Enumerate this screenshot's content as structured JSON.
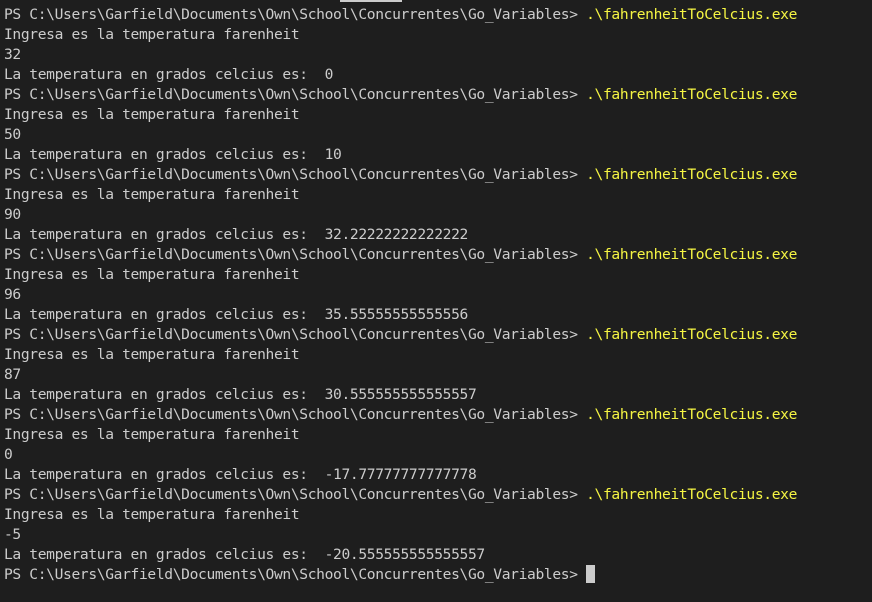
{
  "terminal": {
    "prompt": "PS C:\\Users\\Garfield\\Documents\\Own\\School\\Concurrentes\\Go_Variables>",
    "command": ".\\fahrenheitToCelcius.exe",
    "colors": {
      "background": "#1e1e1e",
      "text": "#cccccc",
      "command": "#f5f543"
    },
    "runs": [
      {
        "question": "Ingresa es la temperatura farenheit",
        "input": "32",
        "result": "La temperatura en grados celcius es:  0"
      },
      {
        "question": "Ingresa es la temperatura farenheit",
        "input": "50",
        "result": "La temperatura en grados celcius es:  10"
      },
      {
        "question": "Ingresa es la temperatura farenheit",
        "input": "90",
        "result": "La temperatura en grados celcius es:  32.22222222222222"
      },
      {
        "question": "Ingresa es la temperatura farenheit",
        "input": "96",
        "result": "La temperatura en grados celcius es:  35.55555555555556"
      },
      {
        "question": "Ingresa es la temperatura farenheit",
        "input": "87",
        "result": "La temperatura en grados celcius es:  30.555555555555557"
      },
      {
        "question": "Ingresa es la temperatura farenheit",
        "input": "0",
        "result": "La temperatura en grados celcius es:  -17.77777777777778"
      },
      {
        "question": "Ingresa es la temperatura farenheit",
        "input": "-5",
        "result": "La temperatura en grados celcius es:  -20.555555555555557"
      }
    ]
  }
}
